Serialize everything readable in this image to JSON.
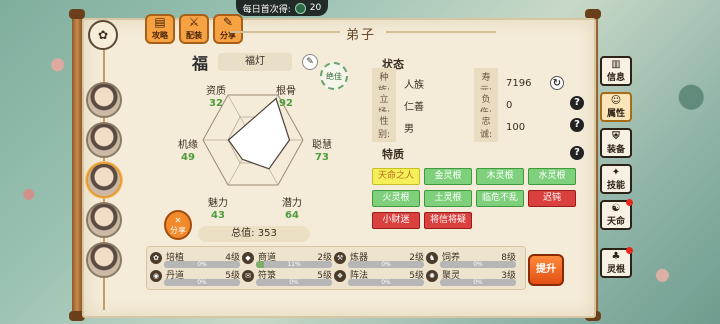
{
  "top_banner": {
    "label": "每日首次得:",
    "amount": "20"
  },
  "top_tabs": [
    {
      "label": "攻略",
      "icon": "book-icon"
    },
    {
      "label": "配装",
      "icon": "equip-icon"
    },
    {
      "label": "分享",
      "icon": "share-icon"
    }
  ],
  "title": "弟子",
  "character": {
    "seal": "福",
    "name": "福灯",
    "badge": "绝佳"
  },
  "stats": [
    {
      "label": "资质",
      "value": "32"
    },
    {
      "label": "根骨",
      "value": "92"
    },
    {
      "label": "聪慧",
      "value": "73"
    },
    {
      "label": "潜力",
      "value": "64"
    },
    {
      "label": "魅力",
      "value": "43"
    },
    {
      "label": "机缘",
      "value": "49"
    }
  ],
  "total": {
    "label": "总值:",
    "value": "353"
  },
  "share_button": "分享",
  "status": {
    "heading": "状态",
    "rows": [
      {
        "label": "种族:",
        "value": "人族"
      },
      {
        "label": "立场:",
        "value": "仁善"
      },
      {
        "label": "性别:",
        "value": "男"
      }
    ],
    "right_rows": [
      {
        "label": "寿元:",
        "value": "7196"
      },
      {
        "label": "负伤:",
        "value": "0"
      },
      {
        "label": "忠诚:",
        "value": "100"
      }
    ]
  },
  "traits": {
    "heading": "特质",
    "items": [
      {
        "label": "天命之人",
        "style": "yellow"
      },
      {
        "label": "金灵根",
        "style": "green"
      },
      {
        "label": "木灵根",
        "style": "green"
      },
      {
        "label": "水灵根",
        "style": "green"
      },
      {
        "label": "火灵根",
        "style": "green"
      },
      {
        "label": "土灵根",
        "style": "green"
      },
      {
        "label": "临危不乱",
        "style": "green"
      },
      {
        "label": "迟钝",
        "style": "red"
      },
      {
        "label": "小财迷",
        "style": "red"
      },
      {
        "label": "将信将疑",
        "style": "red"
      }
    ]
  },
  "skills": [
    {
      "name": "培植",
      "level": "4级",
      "progress": "0%",
      "fraction": 0
    },
    {
      "name": "商道",
      "level": "2级",
      "progress": "11%",
      "fraction": 0.11
    },
    {
      "name": "炼器",
      "level": "2级",
      "progress": "0%",
      "fraction": 0
    },
    {
      "name": "饲养",
      "level": "8级",
      "progress": "0%",
      "fraction": 0
    },
    {
      "name": "丹道",
      "level": "5级",
      "progress": "0%",
      "fraction": 0
    },
    {
      "name": "符箓",
      "level": "5级",
      "progress": "0%",
      "fraction": 0
    },
    {
      "name": "阵法",
      "level": "5级",
      "progress": "0%",
      "fraction": 0
    },
    {
      "name": "聚灵",
      "level": "3级",
      "progress": "0%",
      "fraction": 0
    }
  ],
  "upgrade_button": "提升",
  "side_tabs": [
    {
      "label": "信息",
      "icon": "scroll-icon"
    },
    {
      "label": "属性",
      "icon": "figure-icon"
    },
    {
      "label": "装备",
      "icon": "armor-icon"
    },
    {
      "label": "技能",
      "icon": "skill-icon"
    },
    {
      "label": "天命",
      "icon": "fate-icon"
    },
    {
      "label": "灵根",
      "icon": "root-icon"
    }
  ],
  "colors": {
    "accent": "#f28a2b",
    "stat_value": "#4f9c3c",
    "trait_green": "#7ed07c",
    "trait_red": "#d9403e",
    "trait_yellow": "#f5f05a"
  }
}
